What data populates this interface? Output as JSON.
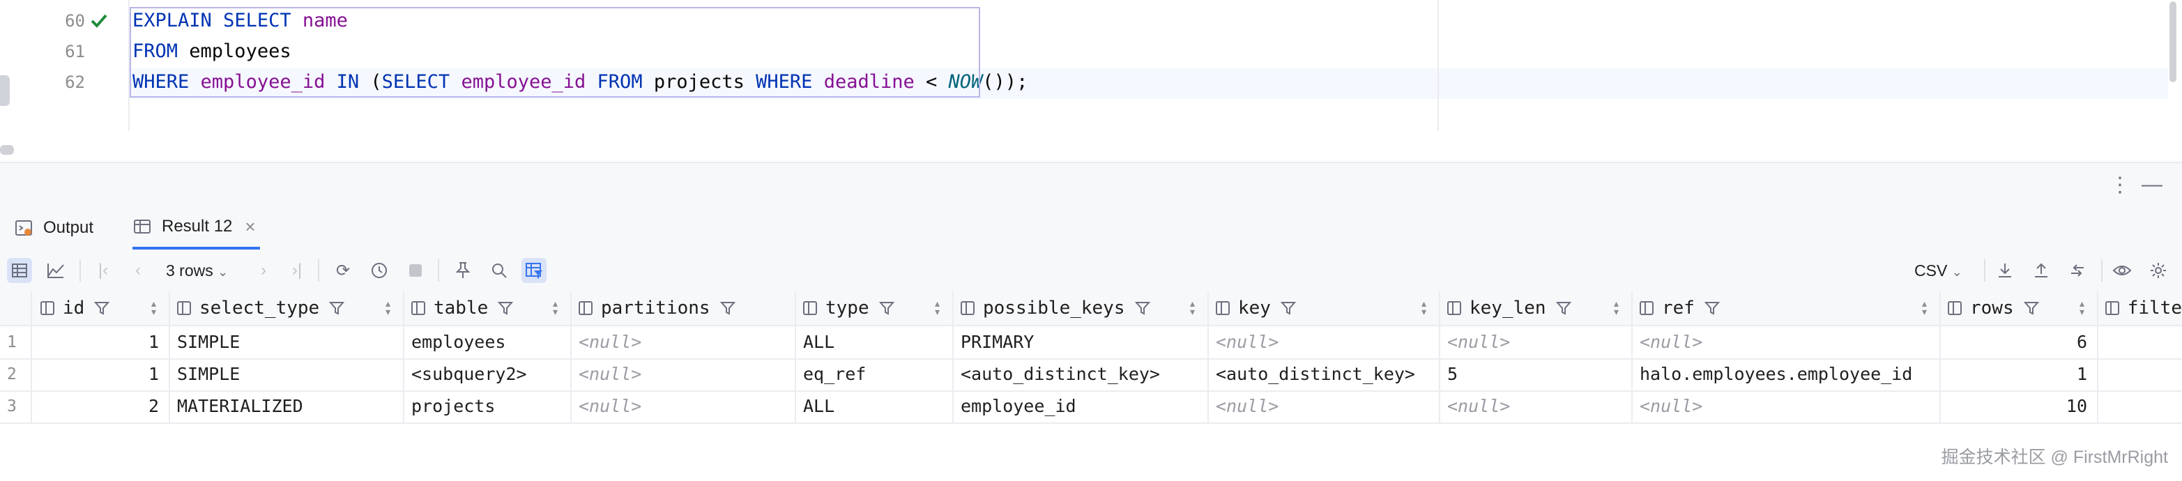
{
  "editor": {
    "lines": [
      {
        "number": "60",
        "tokens": [
          [
            "kw",
            "EXPLAIN"
          ],
          [
            "plain",
            " "
          ],
          [
            "kw",
            "SELECT"
          ],
          [
            "plain",
            " "
          ],
          [
            "col",
            "name"
          ]
        ]
      },
      {
        "number": "61",
        "tokens": [
          [
            "kw",
            "FROM"
          ],
          [
            "plain",
            " employees"
          ]
        ]
      },
      {
        "number": "62",
        "tokens": [
          [
            "kw",
            "WHERE"
          ],
          [
            "plain",
            " "
          ],
          [
            "col",
            "employee_id"
          ],
          [
            "plain",
            " "
          ],
          [
            "kw",
            "IN"
          ],
          [
            "plain",
            " ("
          ],
          [
            "kw",
            "SELECT"
          ],
          [
            "plain",
            " "
          ],
          [
            "col",
            "employee_id"
          ],
          [
            "plain",
            " "
          ],
          [
            "kw",
            "FROM"
          ],
          [
            "plain",
            " projects "
          ],
          [
            "kw",
            "WHERE"
          ],
          [
            "plain",
            " "
          ],
          [
            "col",
            "deadline"
          ],
          [
            "plain",
            " < "
          ],
          [
            "fn",
            "NOW"
          ],
          [
            "plain",
            "());"
          ]
        ]
      }
    ],
    "check_icon": "checkmark-icon"
  },
  "tabs": [
    {
      "label": "Output",
      "icon": "output-console-icon"
    },
    {
      "label": "Result 12",
      "icon": "table-icon",
      "active": true
    }
  ],
  "toolbar": {
    "rows_label": "3 rows",
    "export_format": "CSV"
  },
  "grid": {
    "columns": [
      "id",
      "select_type",
      "table",
      "partitions",
      "type",
      "possible_keys",
      "key",
      "key_len",
      "ref",
      "rows",
      "filte"
    ],
    "rows": [
      {
        "n": "1",
        "id": "1",
        "select_type": "SIMPLE",
        "table": "employees",
        "partitions": "<null>",
        "type": "ALL",
        "possible_keys": "PRIMARY",
        "key": "<null>",
        "key_len": "<null>",
        "ref": "<null>",
        "rows": "6"
      },
      {
        "n": "2",
        "id": "1",
        "select_type": "SIMPLE",
        "table": "<subquery2>",
        "partitions": "<null>",
        "type": "eq_ref",
        "possible_keys": "<auto_distinct_key>",
        "key": "<auto_distinct_key>",
        "key_len": "5",
        "ref": "halo.employees.employee_id",
        "rows": "1"
      },
      {
        "n": "3",
        "id": "2",
        "select_type": "MATERIALIZED",
        "table": "projects",
        "partitions": "<null>",
        "type": "ALL",
        "possible_keys": "employee_id",
        "key": "<null>",
        "key_len": "<null>",
        "ref": "<null>",
        "rows": "10"
      }
    ]
  },
  "watermark": "掘金技术社区 @ FirstMrRight",
  "colors": {
    "accent": "#3574f0",
    "keyword": "#0033b3",
    "column": "#871094",
    "function": "#00627a",
    "check": "#208a3c"
  }
}
